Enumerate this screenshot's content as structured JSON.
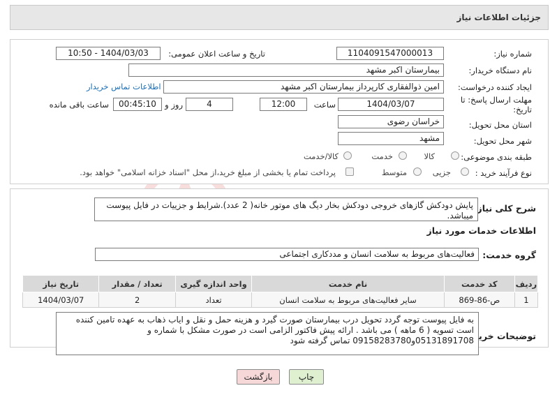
{
  "header": {
    "title": "جزئیات اطلاعات نیاز"
  },
  "fields": {
    "need_number_label": "شماره نیاز:",
    "need_number": "1104091547000013",
    "announce_label": "تاریخ و ساعت اعلان عمومی:",
    "announce_value": "1404/03/03 - 10:50",
    "buyer_org_label": "نام دستگاه خریدار:",
    "buyer_org": "بیمارستان اکبر مشهد",
    "creator_label": "ایجاد کننده درخواست:",
    "creator": "امین ذوالفقاری کارپرداز بیمارستان اکبر مشهد",
    "contact_link": "اطلاعات تماس خریدار",
    "deadline_label_1": "مهلت ارسال پاسخ: تا",
    "deadline_label_2": "تاریخ:",
    "deadline_date": "1404/03/07",
    "time_label": "ساعت",
    "deadline_time": "12:00",
    "days_value": "4",
    "days_label": "روز و",
    "remaining_time": "00:45:10",
    "remaining_label": "ساعت باقی مانده",
    "province_label": "استان محل تحویل:",
    "province": "خراسان رضوی",
    "city_label": "شهر محل تحویل:",
    "city": "مشهد",
    "category_label": "طبقه بندی موضوعی:",
    "category_options": [
      "کالا",
      "خدمت",
      "کالا/خدمت"
    ],
    "process_label": "نوع فرآیند خرید :",
    "process_options": [
      "جزیی",
      "متوسط"
    ],
    "payment_note": "پرداخت تمام یا بخشی از مبلغ خرید،از محل \"اسناد خزانه اسلامی\" خواهد بود."
  },
  "description": {
    "label": "شرح کلی نیاز:",
    "text": "پایش دودکش گازهای خروجی دودکش بخار دیگ های موتور خانه( 2 عدد).شرایط و جزییات در فایل پیوست میباشد."
  },
  "services": {
    "section_title": "اطلاعات خدمات مورد نیاز",
    "group_label": "گروه خدمت:",
    "group_value": "فعالیت‌های مربوط به سلامت انسان و مددکاری اجتماعی",
    "columns": [
      "ردیف",
      "کد خدمت",
      "نام خدمت",
      "واحد اندازه گیری",
      "تعداد / مقدار",
      "تاریخ نیاز"
    ],
    "rows": [
      [
        "1",
        "ص-86-869",
        "سایر فعالیت‌های مربوط به سلامت انسان",
        "تعداد",
        "2",
        "1404/03/07"
      ]
    ]
  },
  "buyer_notes": {
    "label": "توضیحات خریدار:",
    "text": "به فایل پیوست توجه گردد تحویل درب بیمارستان صورت گیرد و هزینه حمل و نقل و ایاب ذهاب به عهده تامین کننده است تسویه ( 6 ماهه ) می باشد . ارائه پیش فاکتور الزامی است در صورت مشکل با شماره  و 05131891708و09158283780 تماس گرفته شود"
  },
  "buttons": {
    "print": "چاپ",
    "back": "بازگشت"
  },
  "colors": {
    "link": "#1a6fb6",
    "back_button_bg": "#f6d8d8",
    "print_button_bg": "#dff0d0",
    "header_bg": "#e7e7e7"
  }
}
